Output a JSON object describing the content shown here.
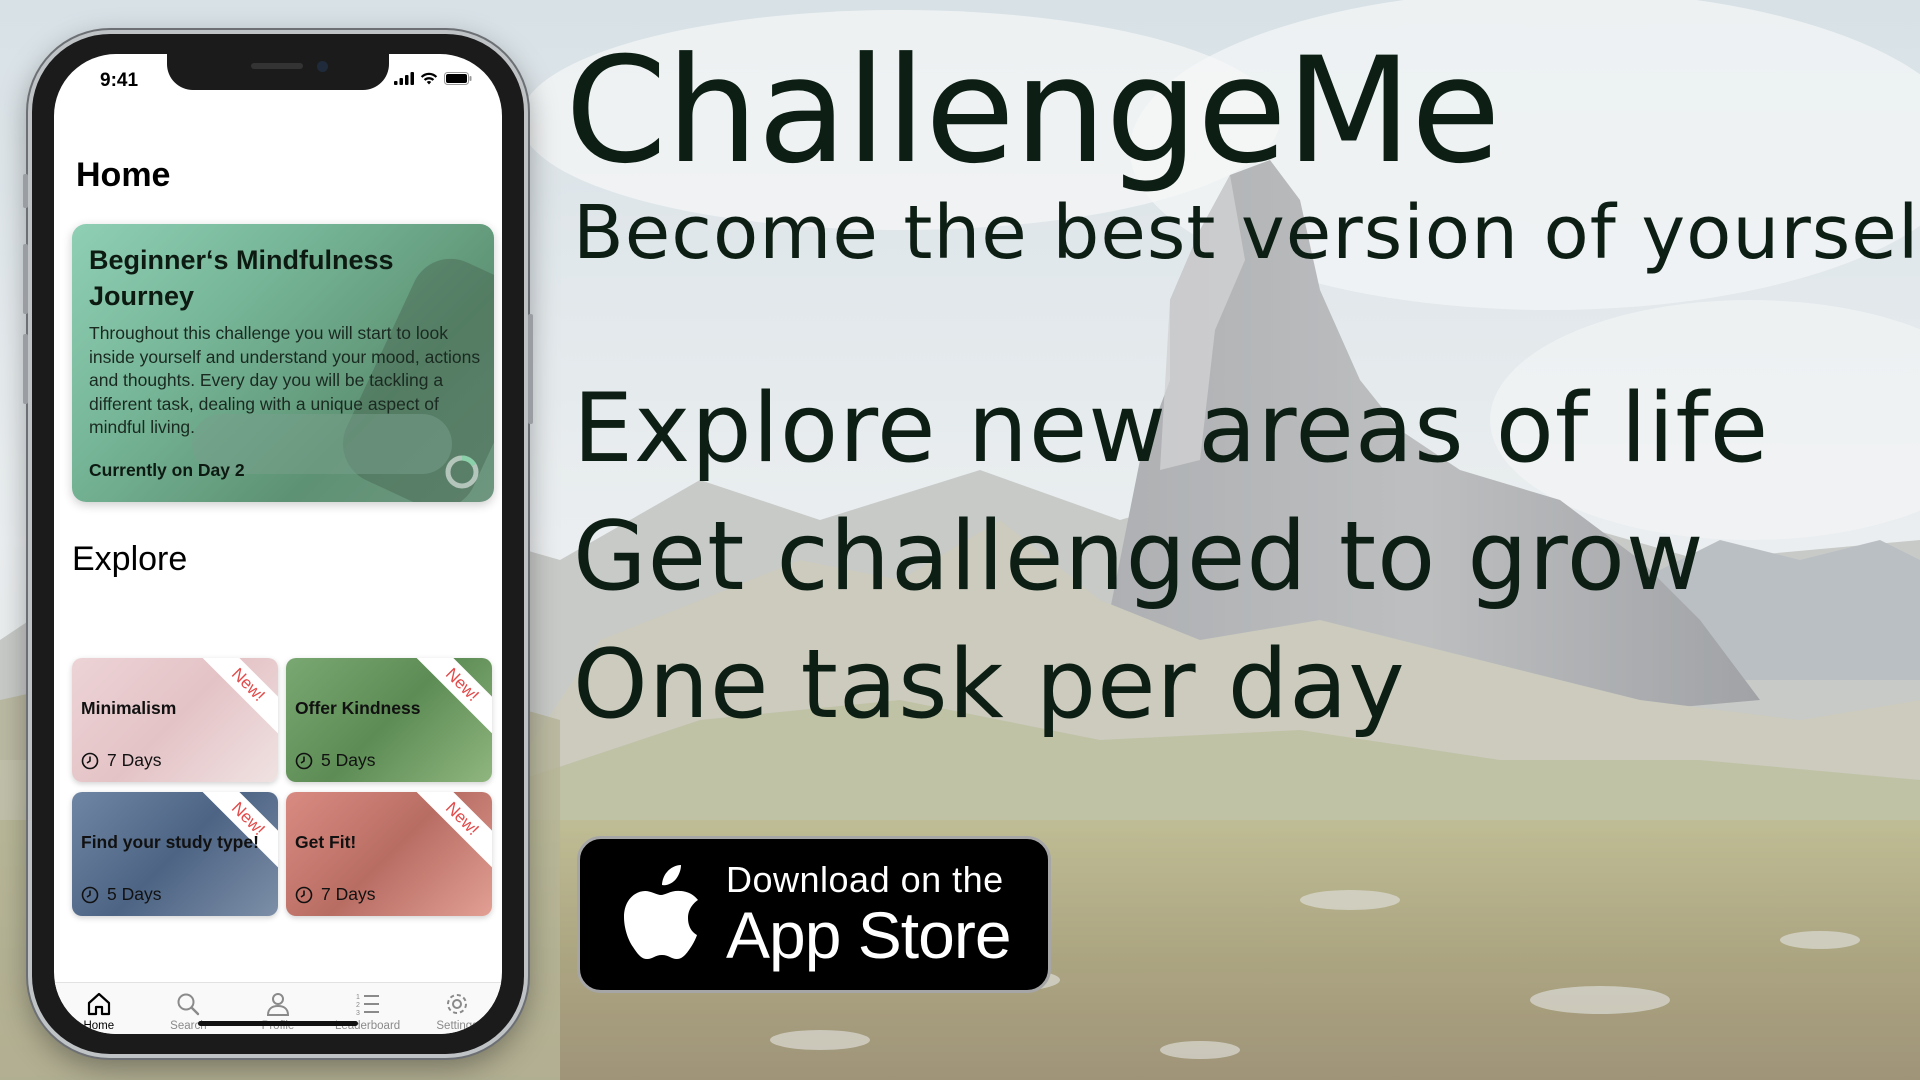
{
  "hero": {
    "title": "ChallengeMe",
    "subtitle": "Become the best version of yourself",
    "features": [
      "Explore new areas of life",
      "Get challenged to grow",
      "One task per day"
    ]
  },
  "badge": {
    "line1": "Download on the",
    "line2": "App Store"
  },
  "phone": {
    "status_time": "9:41",
    "page_title": "Home",
    "featured": {
      "title": "Beginner‘s Mindfulness Journey",
      "description": "Throughout this challenge you will start to look inside yourself and understand your mood, actions and thoughts. Every day you will be tackling a different task, dealing with a unique aspect of mindful living.",
      "progress": "Currently on Day 2"
    },
    "explore_title": "Explore",
    "tiles": [
      {
        "name": "Minimalism",
        "duration": "7 Days",
        "badge": "New!"
      },
      {
        "name": "Offer Kindness",
        "duration": "5 Days",
        "badge": "New!"
      },
      {
        "name": "Find your study type!",
        "duration": "5 Days",
        "badge": "New!"
      },
      {
        "name": "Get Fit!",
        "duration": "7 Days",
        "badge": "New!"
      }
    ],
    "tabs": [
      "Home",
      "Search",
      "Profile",
      "Leaderboard",
      "Settings"
    ],
    "active_tab": "Home"
  },
  "colors": {
    "hero_text": "#0d1f14",
    "ribbon_text": "#e24a4a"
  }
}
